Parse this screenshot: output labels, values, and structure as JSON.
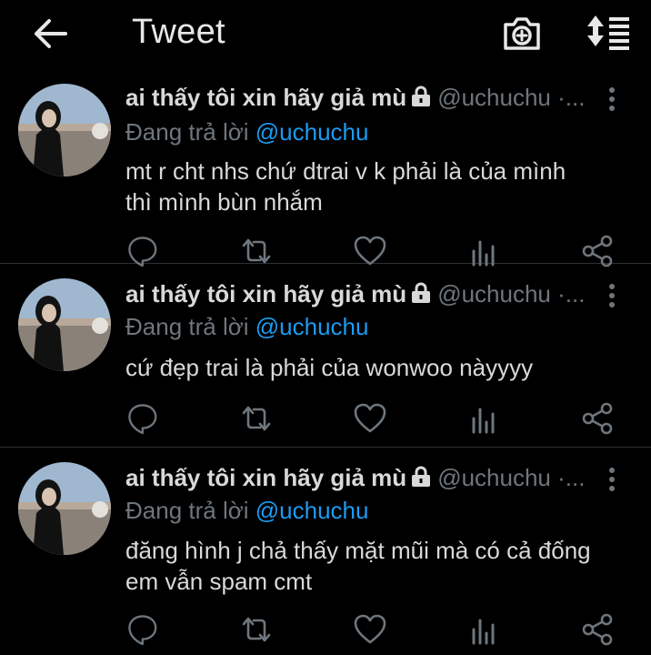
{
  "header": {
    "title": "Tweet"
  },
  "icons": {
    "back": "arrow-left-icon",
    "camera": "camera-plus-icon",
    "sort": "sort-list-icon"
  },
  "colors": {
    "background": "#000000",
    "text": "#d9d9d9",
    "muted": "#6e767d",
    "accent": "#1d9bf0",
    "divider": "#2f3336"
  },
  "tweets": [
    {
      "name": "ai thấy tôi xin hãy giả mù",
      "handle": "@uchuchu ·...",
      "replying_prefix": "Đang trả lời ",
      "replying_to": "@uchuchu",
      "lines": [
        "mt r cht nhs chứ dtrai v k phải là của mình",
        "thì mình bùn nhắm"
      ]
    },
    {
      "name": "ai thấy tôi xin hãy giả mù",
      "handle": "@uchuchu ·...",
      "replying_prefix": "Đang trả lời ",
      "replying_to": "@uchuchu",
      "lines": [
        "cứ đẹp trai là phải của wonwoo nàyyyy"
      ]
    },
    {
      "name": "ai thấy tôi xin hãy giả mù",
      "handle": "@uchuchu ·...",
      "replying_prefix": "Đang trả lời ",
      "replying_to": "@uchuchu",
      "lines": [
        "đăng hình j chả thấy mặt mũi mà có cả đống",
        "em vẫn spam cmt"
      ]
    }
  ]
}
